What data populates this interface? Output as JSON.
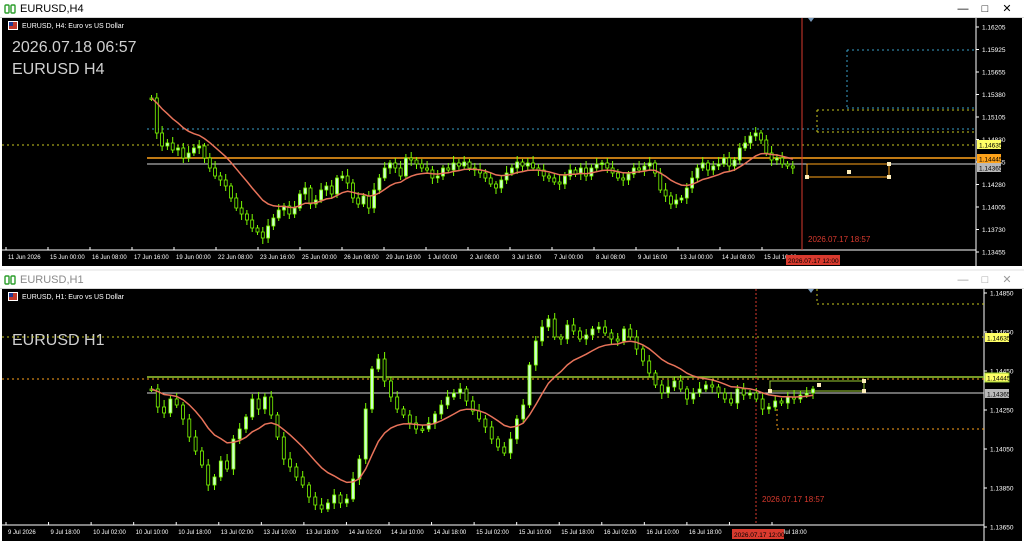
{
  "colors": {
    "background": "#000000",
    "bull": "#ccffcc",
    "bear": "#000000",
    "candle_outline": "#7cfc00",
    "ma": "#e8735a",
    "accent_orange": "#ffa31a",
    "accent_green": "#9acd32",
    "crosshair_red": "#d93a2e",
    "dotted_blue": "#3aa0c8",
    "dotted_yellow": "#c8c820"
  },
  "icons": {
    "app": "mt-chart-icon",
    "chart": "flag-icon",
    "minimize": "minimize-icon",
    "maximize": "maximize-icon",
    "close": "close-icon"
  },
  "top": {
    "window_title": "EURUSD,H4",
    "symbol_desc": "EURUSD, H4:  Euro vs US Dollar",
    "overlay_time": "2026.07.18 06:57",
    "overlay_symbol": "EURUSD H4",
    "crosshair_label": "2026.07.17 18:57",
    "price_axis": [
      "1.16205",
      "1.15925",
      "1.15655",
      "1.15380",
      "1.15105",
      "1.14830",
      "1.14555",
      "1.14280",
      "1.14005",
      "1.13730",
      "1.13455"
    ],
    "price_tags": [
      {
        "text": "1.14635",
        "color": "yellow"
      },
      {
        "text": "1.14445",
        "color": "orange"
      },
      {
        "text": "1.14365",
        "color": "gray"
      }
    ],
    "time_axis": [
      "11 Jun 2026",
      "15 Jun 00:00",
      "16 Jun 08:00",
      "17 Jun 16:00",
      "19 Jun 00:00",
      "22 Jun 08:00",
      "23 Jun 16:00",
      "25 Jun 00:00",
      "26 Jun 08:00",
      "29 Jun 16:00",
      "1 Jul 00:00",
      "2 Jul 08:00",
      "3 Jul 16:00",
      "7 Jul 00:00",
      "8 Jul 08:00",
      "9 Jul 16:00",
      "13 Jul 00:00",
      "14 Jul 08:00",
      "15 Jul 16:00"
    ],
    "time_tag": "2026.07.17 12:00"
  },
  "bottom": {
    "window_title": "EURUSD,H1",
    "symbol_desc": "EURUSD, H1:  Euro vs US Dollar",
    "overlay_symbol": "EURUSD H1",
    "crosshair_label": "2026.07.17 18:57",
    "price_axis": [
      "1.14850",
      "1.14650",
      "1.14450",
      "1.14250",
      "1.14050",
      "1.13850",
      "1.13650"
    ],
    "price_tags": [
      {
        "text": "1.14635",
        "color": "yellow"
      },
      {
        "text": "1.14445",
        "color": "green"
      },
      {
        "text": "1.14365",
        "color": "gray"
      }
    ],
    "time_axis": [
      "9 Jul 2026",
      "9 Jul 18:00",
      "10 Jul 02:00",
      "10 Jul 10:00",
      "10 Jul 18:00",
      "13 Jul 02:00",
      "13 Jul 10:00",
      "13 Jul 18:00",
      "14 Jul 02:00",
      "14 Jul 10:00",
      "14 Jul 18:00",
      "15 Jul 02:00",
      "15 Jul 10:00",
      "15 Jul 18:00",
      "16 Jul 02:00",
      "16 Jul 10:00",
      "16 Jul 18:00",
      "17 Jul 02:00",
      "17 Jul 18:00"
    ],
    "time_tag": "2026.07.17 12:00"
  }
}
